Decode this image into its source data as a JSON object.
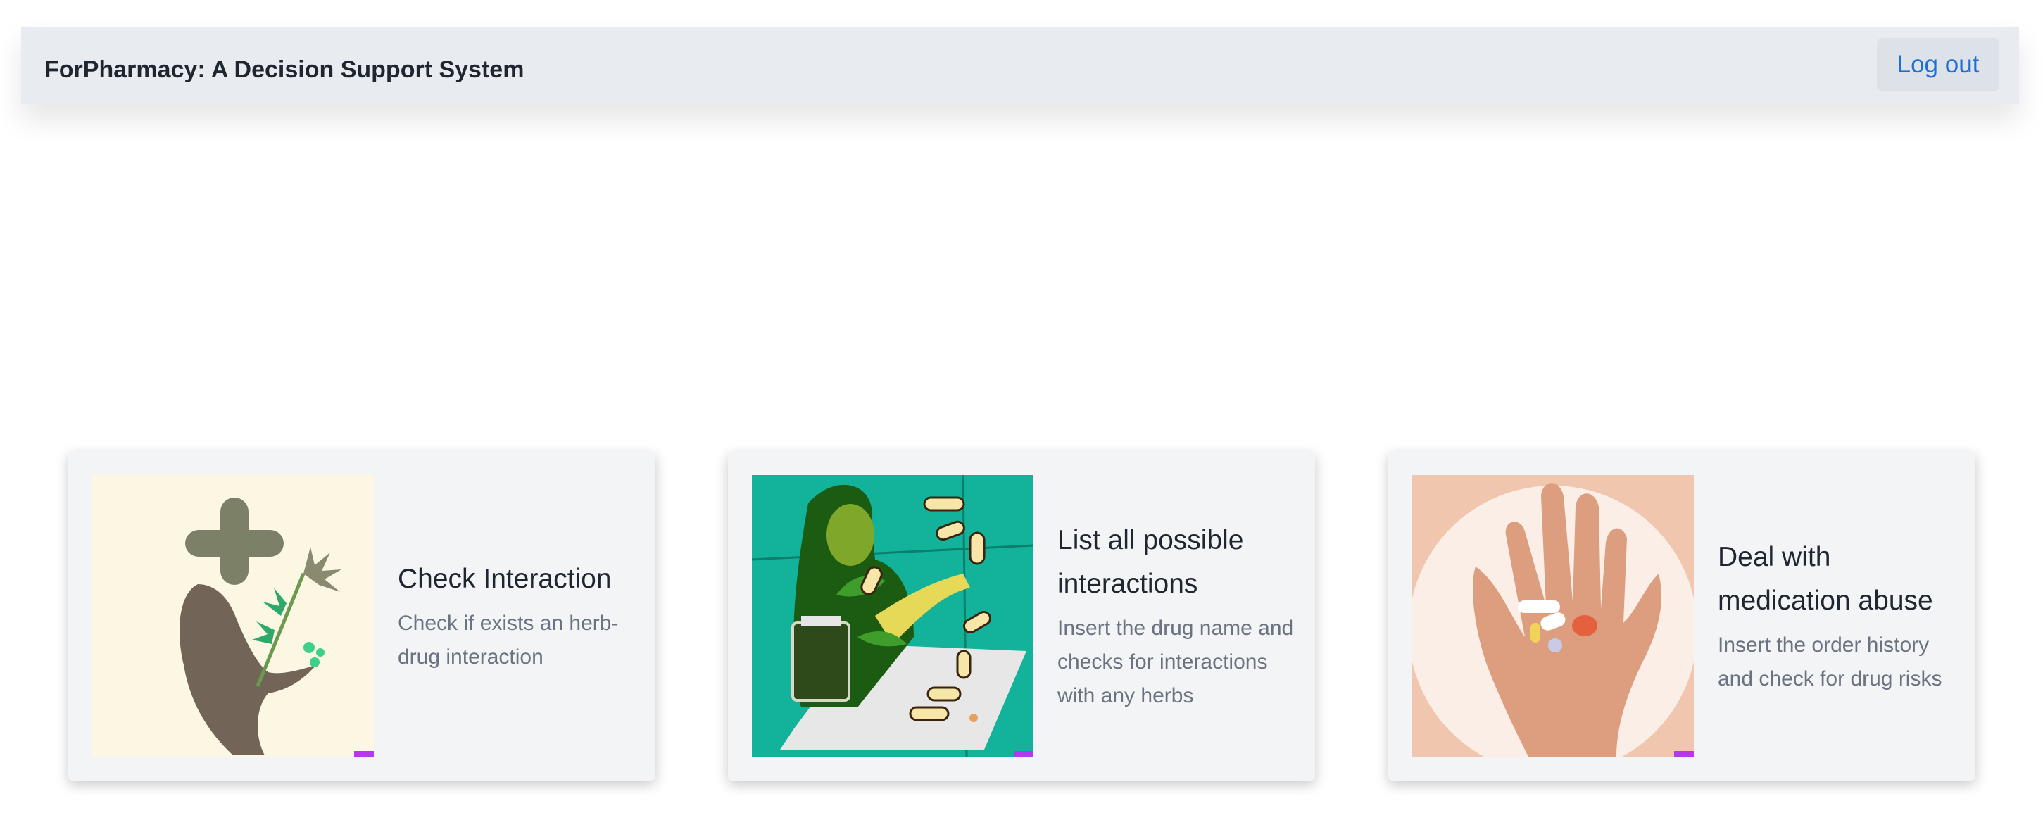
{
  "navbar": {
    "brand": "ForPharmacy: A Decision Support System",
    "logout_label": "Log out"
  },
  "cards": [
    {
      "title": "Check Interaction",
      "description": "Check if exists an herb-drug interaction",
      "image_icon": "herb-hand-cross-illustration"
    },
    {
      "title": "List all possible interactions",
      "description": "Insert the drug name and checks for interactions with any herbs",
      "image_icon": "person-pills-leaves-illustration"
    },
    {
      "title": "Deal with medication abuse",
      "description": "Insert the order history and check for drug risks",
      "image_icon": "hand-with-pills-illustration"
    }
  ],
  "colors": {
    "navbar_bg": "#e8ecf1",
    "link": "#1f6fd6",
    "card_bg": "#f3f4f6",
    "title_text": "#1f2630",
    "muted_text": "#6b7380"
  }
}
